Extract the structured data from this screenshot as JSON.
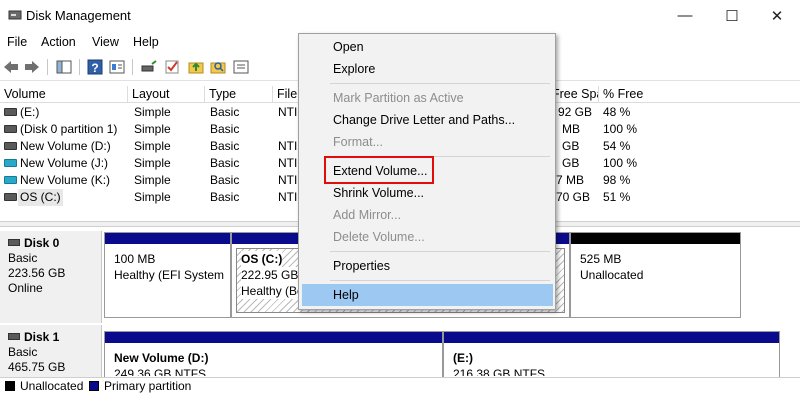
{
  "window": {
    "title": "Disk Management",
    "controls": {
      "minimize": "—",
      "maximize": "☐",
      "close": "✕"
    }
  },
  "menubar": [
    "File",
    "Action",
    "View",
    "Help"
  ],
  "toolbar_icons": [
    "back-arrow-icon",
    "forward-arrow-icon",
    "console-tree-icon",
    "help-icon",
    "properties-icon",
    "refresh-icon",
    "check-icon",
    "up-folder-icon",
    "search-icon",
    "settings-icon"
  ],
  "table": {
    "columns": [
      "Volume",
      "Layout",
      "Type",
      "File",
      "Free Spa...",
      "% Free"
    ],
    "rows": [
      {
        "volume": "(E:)",
        "layout": "Simple",
        "type": "Basic",
        "fs": "NTI",
        "free": "92 GB",
        "pct": "48 %",
        "icon": "gray"
      },
      {
        "volume": "(Disk 0 partition 1)",
        "layout": "Simple",
        "type": "Basic",
        "fs": "",
        "free": "MB",
        "pct": "100 %",
        "icon": "gray"
      },
      {
        "volume": "New Volume (D:)",
        "layout": "Simple",
        "type": "Basic",
        "fs": "NTI",
        "free": "GB",
        "pct": "54 %",
        "icon": "gray"
      },
      {
        "volume": "New Volume (J:)",
        "layout": "Simple",
        "type": "Basic",
        "fs": "NTI",
        "free": "GB",
        "pct": "100 %",
        "icon": "cyan"
      },
      {
        "volume": "New Volume (K:)",
        "layout": "Simple",
        "type": "Basic",
        "fs": "NTI",
        "free": "7 MB",
        "pct": "98 %",
        "icon": "cyan"
      },
      {
        "volume": "OS (C:)",
        "layout": "Simple",
        "type": "Basic",
        "fs": "NTI",
        "free": "70 GB",
        "pct": "51 %",
        "icon": "gray"
      }
    ]
  },
  "disks": [
    {
      "name": "Disk 0",
      "kind": "Basic",
      "size": "223.56 GB",
      "status": "Online",
      "partitions": [
        {
          "title": "",
          "line1": "100 MB",
          "line2": "Healthy (EFI System P"
        },
        {
          "title": "OS  (C:)",
          "line1": "222.95 GB N",
          "line2": "Healthy (Bo"
        },
        {
          "title": "",
          "line1": "525 MB",
          "line2": "Unallocated"
        }
      ]
    },
    {
      "name": "Disk 1",
      "kind": "Basic",
      "size": "465.75 GB",
      "status": "",
      "partitions": [
        {
          "title": "New Volume  (D:)",
          "line1": "249.36 GB NTFS",
          "line2": ""
        },
        {
          "title": "(E:)",
          "line1": "216.38 GB NTFS",
          "line2": ""
        }
      ]
    }
  ],
  "legend": {
    "unallocated": "Unallocated",
    "primary": "Primary partition",
    "unallocated_color": "#000000",
    "primary_color": "#0a0a8c"
  },
  "context_menu": {
    "items": [
      {
        "label": "Open",
        "enabled": true
      },
      {
        "label": "Explore",
        "enabled": true
      },
      {
        "label": "Mark Partition as Active",
        "enabled": false
      },
      {
        "label": "Change Drive Letter and Paths...",
        "enabled": true
      },
      {
        "label": "Format...",
        "enabled": false
      },
      {
        "label": "Extend Volume...",
        "enabled": true,
        "boxed": true
      },
      {
        "label": "Shrink Volume...",
        "enabled": true
      },
      {
        "label": "Add Mirror...",
        "enabled": false
      },
      {
        "label": "Delete Volume...",
        "enabled": false
      },
      {
        "label": "Properties",
        "enabled": true
      },
      {
        "label": "Help",
        "enabled": true,
        "highlighted": true
      }
    ]
  },
  "colors": {
    "partition_bar": "#0a0a8c",
    "unallocated_bar": "#000000",
    "highlight": "#9dc8f1",
    "annotation_box": "#e00d0d"
  }
}
